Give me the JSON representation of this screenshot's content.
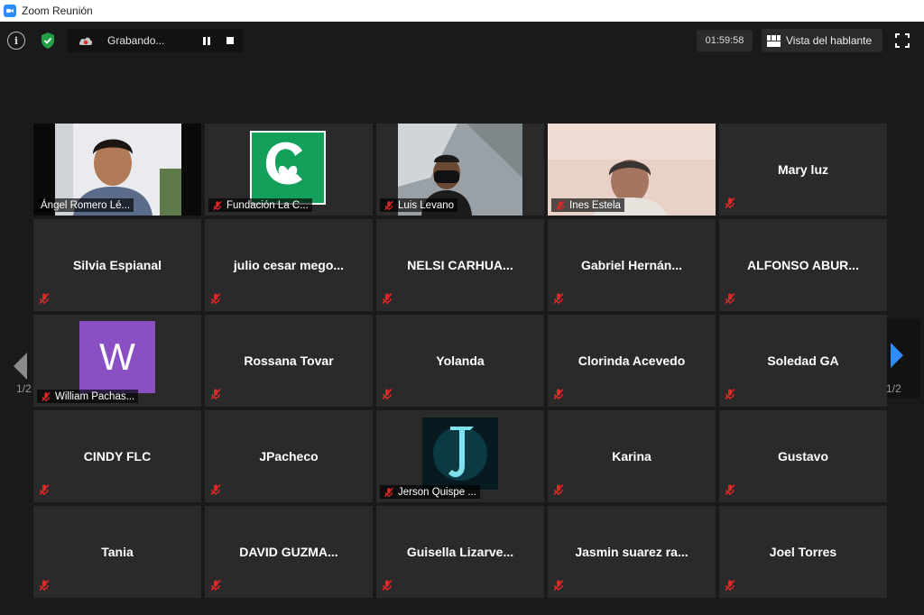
{
  "window": {
    "title": "Zoom Reunión"
  },
  "toolbar": {
    "info_glyph": "i",
    "recording_label": "Grabando...",
    "timer": "01:59:58",
    "view_label": "Vista del hablante"
  },
  "pagination": {
    "left": "1/2",
    "right": "1/2"
  },
  "participants": [
    {
      "name": "Ángel Romero Lé...",
      "type": "video",
      "active": true
    },
    {
      "name": "Fundación La C...",
      "type": "logo"
    },
    {
      "name": "Luis Levano",
      "type": "video"
    },
    {
      "name": "Ines Estela",
      "type": "video"
    },
    {
      "name": "Mary luz",
      "type": "name"
    },
    {
      "name": "Silvia Espianal",
      "type": "name"
    },
    {
      "name": "julio cesar mego...",
      "type": "name"
    },
    {
      "name": "NELSI CARHUA...",
      "type": "name"
    },
    {
      "name": "Gabriel Hernán...",
      "type": "name"
    },
    {
      "name": "ALFONSO ABUR...",
      "type": "name"
    },
    {
      "name": "William Pachas...",
      "type": "avatar",
      "avatar_letter": "W",
      "avatar_color": "#8b4fc4"
    },
    {
      "name": "Rossana Tovar",
      "type": "name"
    },
    {
      "name": "Yolanda",
      "type": "name"
    },
    {
      "name": "Clorinda Acevedo",
      "type": "name"
    },
    {
      "name": "Soledad GA",
      "type": "name"
    },
    {
      "name": "CINDY FLC",
      "type": "name"
    },
    {
      "name": "JPacheco",
      "type": "name"
    },
    {
      "name": "Jerson Quispe ...",
      "type": "image"
    },
    {
      "name": "Karina",
      "type": "name"
    },
    {
      "name": "Gustavo",
      "type": "name"
    },
    {
      "name": "Tania",
      "type": "name"
    },
    {
      "name": "DAVID GUZMA...",
      "type": "name"
    },
    {
      "name": "Guisella Lizarve...",
      "type": "name"
    },
    {
      "name": "Jasmin suarez ra...",
      "type": "name"
    },
    {
      "name": "Joel Torres",
      "type": "name"
    }
  ],
  "colors": {
    "active_border": "#b4d84b",
    "mute_red": "#e02828",
    "accent": "#2d8cff"
  }
}
